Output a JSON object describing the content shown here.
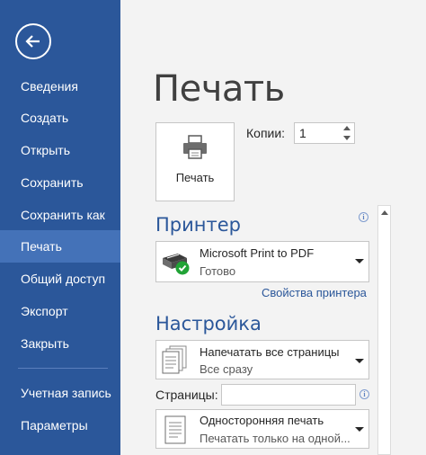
{
  "sidebar": {
    "items": [
      {
        "label": "Сведения"
      },
      {
        "label": "Создать"
      },
      {
        "label": "Открыть"
      },
      {
        "label": "Сохранить"
      },
      {
        "label": "Сохранить как"
      },
      {
        "label": "Печать"
      },
      {
        "label": "Общий доступ"
      },
      {
        "label": "Экспорт"
      },
      {
        "label": "Закрыть"
      },
      {
        "label": "Учетная запись"
      },
      {
        "label": "Параметры"
      }
    ],
    "active_item": "Печать"
  },
  "page_title": "Печать",
  "print_button": {
    "label": "Печать"
  },
  "copies": {
    "label": "Копии:",
    "value": "1"
  },
  "printer_section": {
    "heading": "Принтер",
    "printer_name": "Microsoft Print to PDF",
    "printer_status": "Готово",
    "properties_link": "Свойства принтера"
  },
  "settings_section": {
    "heading": "Настройка",
    "print_range": {
      "title": "Напечатать все страницы",
      "subtitle": "Все сразу"
    },
    "pages": {
      "label": "Страницы:",
      "value": ""
    },
    "sides": {
      "title": "Односторонняя печать",
      "subtitle": "Печатать только на одной..."
    }
  },
  "colors": {
    "accent": "#2b579a",
    "sidebar_active": "#4472b8",
    "background": "#f3f3f3"
  }
}
